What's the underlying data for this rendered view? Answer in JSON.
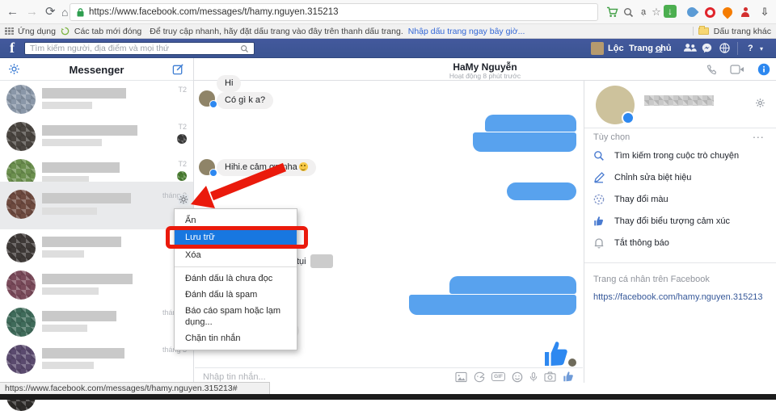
{
  "browser": {
    "url": "https://www.facebook.com/messages/t/hamy.nguyen.315213",
    "address_extra_glyph": "ạ",
    "bookmarks": {
      "apps_label": "Ứng dụng",
      "closed_tabs_label": "Các tab mới đóng",
      "hint_text": "Để truy cập nhanh, hãy đặt dấu trang vào đây trên thanh dấu trang.",
      "import_link": "Nhập dấu trang ngay bây giờ...",
      "other_bookmarks_label": "Dấu trang khác"
    }
  },
  "fb_header": {
    "logo": "f",
    "search_placeholder": "Tìm kiếm người, địa điểm và mọi thứ",
    "user_name": "Lộc",
    "home_label": "Trang chủ",
    "home_badge": "11",
    "help_glyph": "?",
    "caret_glyph": "▾"
  },
  "sidebar": {
    "title": "Messenger",
    "rows": [
      {
        "time": "T2"
      },
      {
        "time": "T2"
      },
      {
        "time": "T2"
      },
      {
        "time": "tháng 3"
      },
      {
        "time": ""
      },
      {
        "time": ""
      },
      {
        "time": "tháng 3"
      },
      {
        "time": "tháng 3"
      }
    ]
  },
  "chat": {
    "title": "HaMy Nguyễn",
    "status": "Hoạt động 8 phút trước",
    "messages": {
      "m1": "Hi",
      "m2": "Có gì k a?",
      "m3": "Hihi.e cảm ơn nha",
      "m4_fragment": "tụi",
      "m5": "Hi.a ngủ ngon :))"
    },
    "input_placeholder": "Nhập tin nhắn...",
    "gif_label": "GIF"
  },
  "context_menu": {
    "items": [
      "Ẩn",
      "Lưu trữ",
      "Xóa",
      "Đánh dấu là chưa đọc",
      "Đánh dấu là spam",
      "Báo cáo spam hoặc lạm dụng...",
      "Chặn tin nhắn"
    ],
    "highlighted_item": "Lưu trữ",
    "highlight_color": "#1877e0",
    "annotation_color": "#ea1a0c"
  },
  "right_sidebar": {
    "options_title": "Tùy chọn",
    "more_label": "...",
    "options": [
      "Tìm kiếm trong cuộc trò chuyện",
      "Chỉnh sửa biệt hiệu",
      "Thay đổi màu",
      "Thay đổi biểu tượng cảm xúc",
      "Tắt thông báo"
    ],
    "profile_section_title": "Trang cá nhân trên Facebook",
    "profile_link": "https://facebook.com/hamy.nguyen.315213"
  },
  "status_bar": {
    "text": "https://www.facebook.com/messages/t/hamy.nguyen.315213#"
  },
  "colors": {
    "fb_blue": "#3b5492",
    "accent_blue": "#2d88f0",
    "annotation_red": "#ea1a0c",
    "download_green": "#4caf50"
  }
}
